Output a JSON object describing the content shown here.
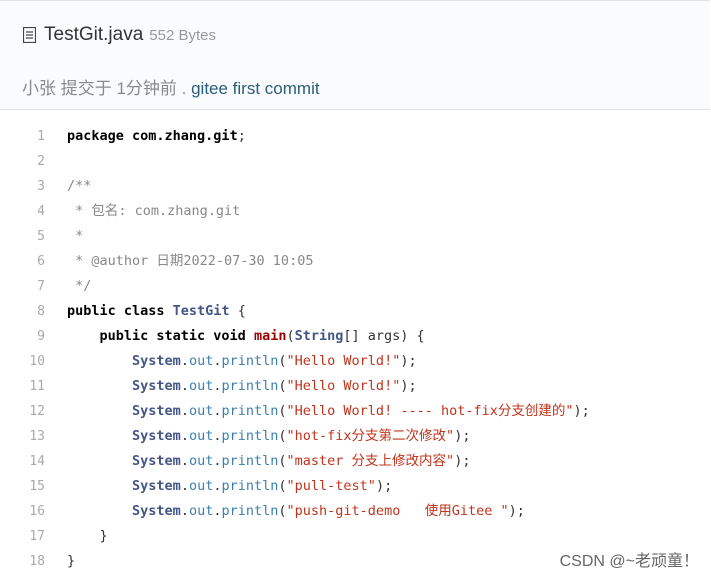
{
  "file": {
    "name": "TestGit.java",
    "size": "552 Bytes"
  },
  "commit": {
    "author_time": "小张 提交于 1分钟前 .",
    "message": "gitee first commit"
  },
  "code_lines": [
    {
      "n": "1",
      "parts": [
        [
          "kw",
          "package "
        ],
        [
          "kw",
          "com.zhang.git"
        ],
        [
          "",
          "; "
        ]
      ]
    },
    {
      "n": "2",
      "parts": []
    },
    {
      "n": "3",
      "parts": [
        [
          "cmt",
          "/**"
        ]
      ]
    },
    {
      "n": "4",
      "parts": [
        [
          "cmt",
          " * 包名: com.zhang.git"
        ]
      ]
    },
    {
      "n": "5",
      "parts": [
        [
          "cmt",
          " *"
        ]
      ]
    },
    {
      "n": "6",
      "parts": [
        [
          "cmt",
          " * @author 日期2022-07-30 10:05"
        ]
      ]
    },
    {
      "n": "7",
      "parts": [
        [
          "cmt",
          " */"
        ]
      ]
    },
    {
      "n": "8",
      "parts": [
        [
          "kw",
          "public class "
        ],
        [
          "cls",
          "TestGit"
        ],
        [
          "",
          " {"
        ]
      ]
    },
    {
      "n": "9",
      "parts": [
        [
          "",
          "    "
        ],
        [
          "kw",
          "public static void "
        ],
        [
          "mth",
          "main"
        ],
        [
          "",
          "("
        ],
        [
          "cls",
          "String"
        ],
        [
          "",
          "[] args) {"
        ]
      ]
    },
    {
      "n": "10",
      "parts": [
        [
          "",
          "        "
        ],
        [
          "cls",
          "System"
        ],
        [
          "",
          "."
        ],
        [
          "fld",
          "out"
        ],
        [
          "",
          "."
        ],
        [
          "fld",
          "println"
        ],
        [
          "",
          "("
        ],
        [
          "str",
          "\"Hello World!\""
        ],
        [
          "",
          ");"
        ]
      ]
    },
    {
      "n": "11",
      "parts": [
        [
          "",
          "        "
        ],
        [
          "cls",
          "System"
        ],
        [
          "",
          "."
        ],
        [
          "fld",
          "out"
        ],
        [
          "",
          "."
        ],
        [
          "fld",
          "println"
        ],
        [
          "",
          "("
        ],
        [
          "str",
          "\"Hello World!\""
        ],
        [
          "",
          ");"
        ]
      ]
    },
    {
      "n": "12",
      "parts": [
        [
          "",
          "        "
        ],
        [
          "cls",
          "System"
        ],
        [
          "",
          "."
        ],
        [
          "fld",
          "out"
        ],
        [
          "",
          "."
        ],
        [
          "fld",
          "println"
        ],
        [
          "",
          "("
        ],
        [
          "str",
          "\"Hello World! ---- hot-fix分支创建的\""
        ],
        [
          "",
          ");"
        ]
      ]
    },
    {
      "n": "13",
      "parts": [
        [
          "",
          "        "
        ],
        [
          "cls",
          "System"
        ],
        [
          "",
          "."
        ],
        [
          "fld",
          "out"
        ],
        [
          "",
          "."
        ],
        [
          "fld",
          "println"
        ],
        [
          "",
          "("
        ],
        [
          "str",
          "\"hot-fix分支第二次修改\""
        ],
        [
          "",
          ");"
        ]
      ]
    },
    {
      "n": "14",
      "parts": [
        [
          "",
          "        "
        ],
        [
          "cls",
          "System"
        ],
        [
          "",
          "."
        ],
        [
          "fld",
          "out"
        ],
        [
          "",
          "."
        ],
        [
          "fld",
          "println"
        ],
        [
          "",
          "("
        ],
        [
          "str",
          "\"master 分支上修改内容\""
        ],
        [
          "",
          ");"
        ]
      ]
    },
    {
      "n": "15",
      "parts": [
        [
          "",
          "        "
        ],
        [
          "cls",
          "System"
        ],
        [
          "",
          "."
        ],
        [
          "fld",
          "out"
        ],
        [
          "",
          "."
        ],
        [
          "fld",
          "println"
        ],
        [
          "",
          "("
        ],
        [
          "str",
          "\"pull-test\""
        ],
        [
          "",
          ");"
        ]
      ]
    },
    {
      "n": "16",
      "parts": [
        [
          "",
          "        "
        ],
        [
          "cls",
          "System"
        ],
        [
          "",
          "."
        ],
        [
          "fld",
          "out"
        ],
        [
          "",
          "."
        ],
        [
          "fld",
          "println"
        ],
        [
          "",
          "("
        ],
        [
          "str",
          "\"push-git-demo   使用Gitee \""
        ],
        [
          "",
          ");"
        ]
      ]
    },
    {
      "n": "17",
      "parts": [
        [
          "",
          "    }"
        ]
      ]
    },
    {
      "n": "18",
      "parts": [
        [
          "",
          "}"
        ]
      ]
    }
  ],
  "watermark": "CSDN @~老顽童！"
}
